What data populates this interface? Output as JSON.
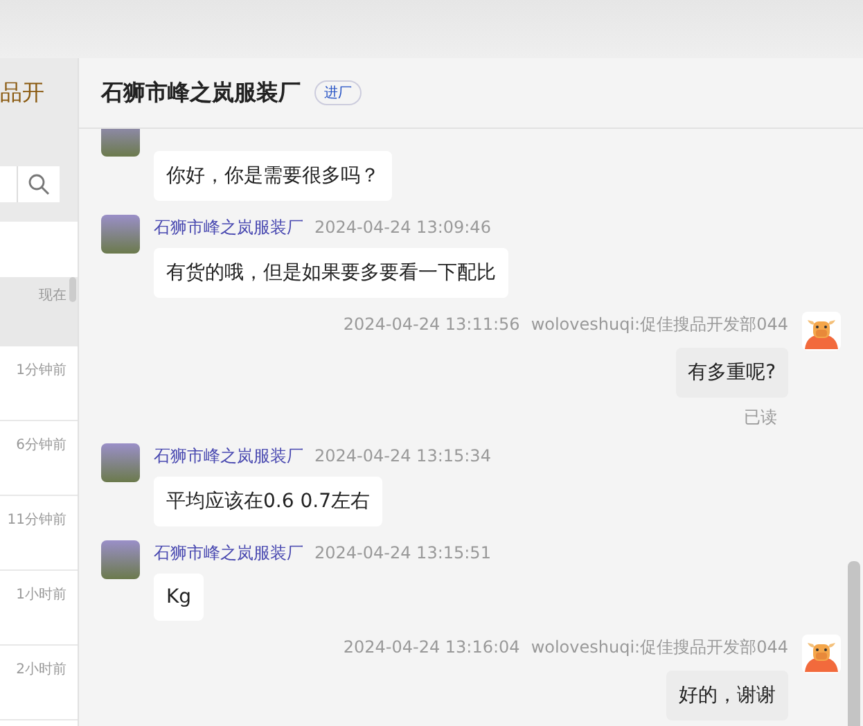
{
  "sidebar": {
    "partial_title": "品开",
    "conversations": [
      {
        "time": "现在",
        "selected": true
      },
      {
        "time": "1分钟前",
        "selected": false
      },
      {
        "time": "6分钟前",
        "selected": false
      },
      {
        "time": "11分钟前",
        "selected": false
      },
      {
        "time": "1小时前",
        "selected": false
      },
      {
        "time": "2小时前",
        "selected": false
      }
    ]
  },
  "chat": {
    "title": "石狮市峰之岚服装厂",
    "badge": "进厂",
    "messages": [
      {
        "kind": "incoming",
        "text": "你好，你是需要很多吗？"
      },
      {
        "kind": "incoming",
        "sender": "石狮市峰之岚服装厂",
        "time": "2024-04-24 13:09:46",
        "text": "有货的哦，但是如果要多要看一下配比"
      },
      {
        "kind": "outgoing",
        "sender": "woloveshuqi:促佳搜品开发部044",
        "time": "2024-04-24 13:11:56",
        "text": "有多重呢?",
        "receipt": "已读"
      },
      {
        "kind": "incoming",
        "sender": "石狮市峰之岚服装厂",
        "time": "2024-04-24 13:15:34",
        "text": "平均应该在0.6 0.7左右"
      },
      {
        "kind": "incoming",
        "sender": "石狮市峰之岚服装厂",
        "time": "2024-04-24 13:15:51",
        "text": "Kg"
      },
      {
        "kind": "outgoing",
        "sender": "woloveshuqi:促佳搜品开发部044",
        "time": "2024-04-24 13:16:04",
        "text": "好的，谢谢"
      }
    ]
  }
}
